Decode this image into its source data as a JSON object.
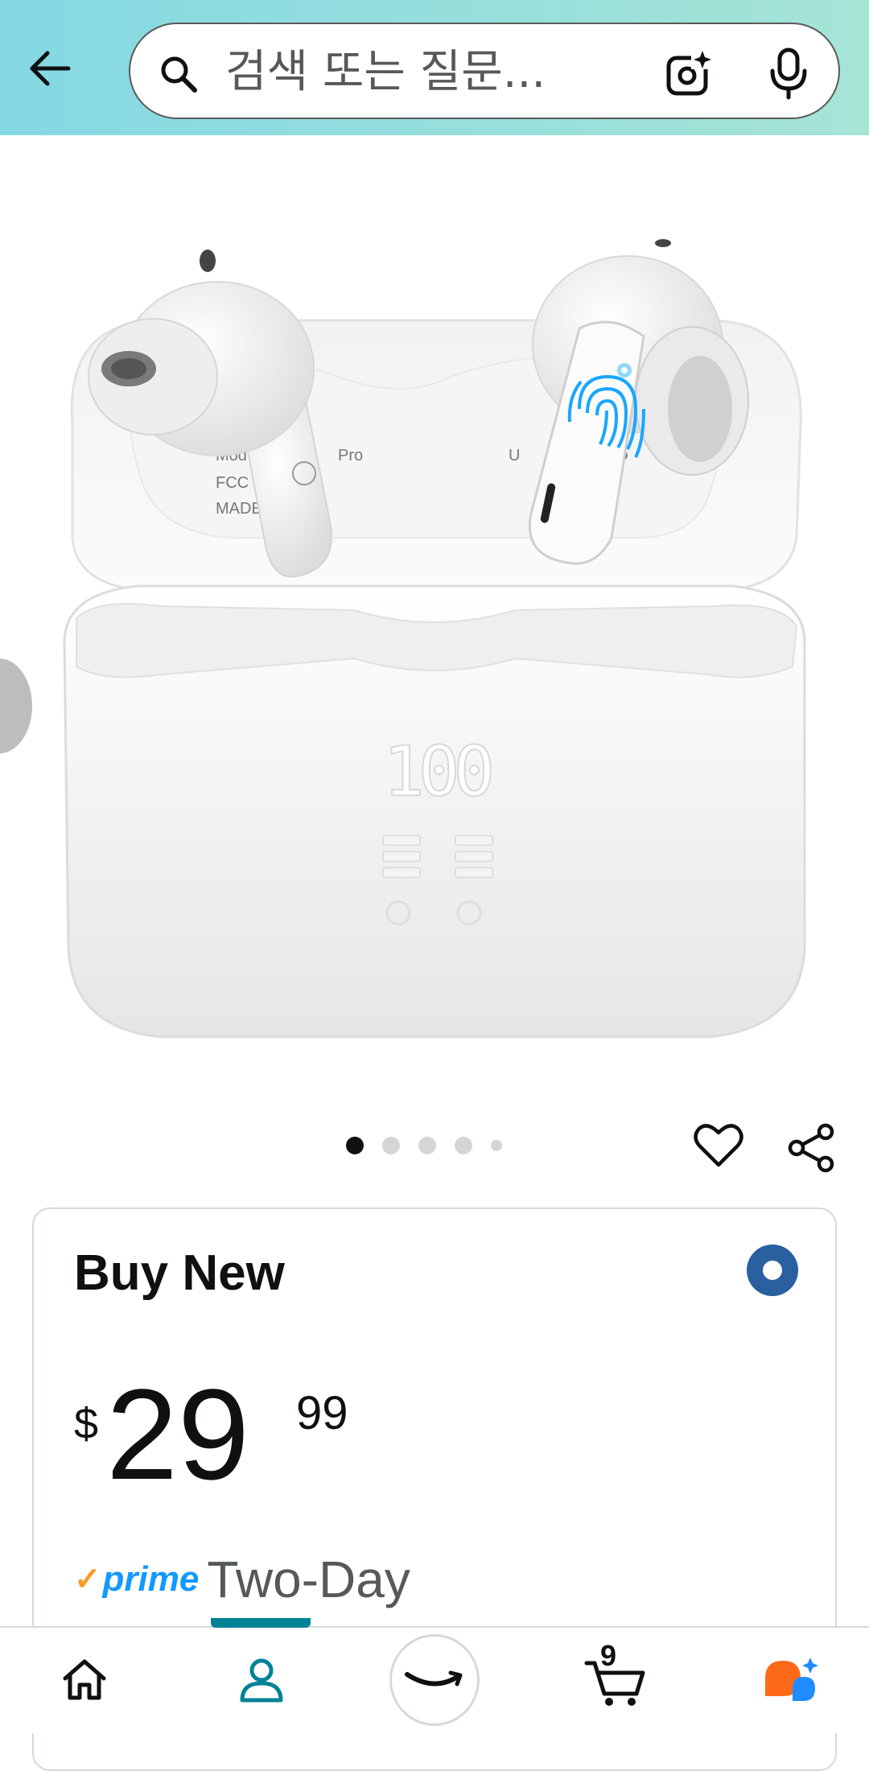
{
  "header": {
    "search_placeholder": "검색 또는 질문..."
  },
  "product": {
    "image_alt": "Wireless earbuds with LED charging case",
    "case_display": "100",
    "carousel": {
      "total": 5,
      "active_index": 0
    }
  },
  "buy_box": {
    "title": "Buy New",
    "price_symbol": "$",
    "price_whole": "29",
    "price_fraction": "99",
    "prime_label": "prime",
    "delivery_text": "Two-Day"
  },
  "nav": {
    "cart_count": "9",
    "items": [
      "home",
      "you",
      "amazon",
      "cart",
      "rufus"
    ]
  },
  "colors": {
    "header_start": "#84d8e3",
    "header_end": "#a6e4d6",
    "radio_selected": "#2a5fa0",
    "prime_blue": "#1399ff",
    "prime_check": "#f59d2a",
    "nav_active": "#008296",
    "fingerprint": "#19a7ff"
  }
}
